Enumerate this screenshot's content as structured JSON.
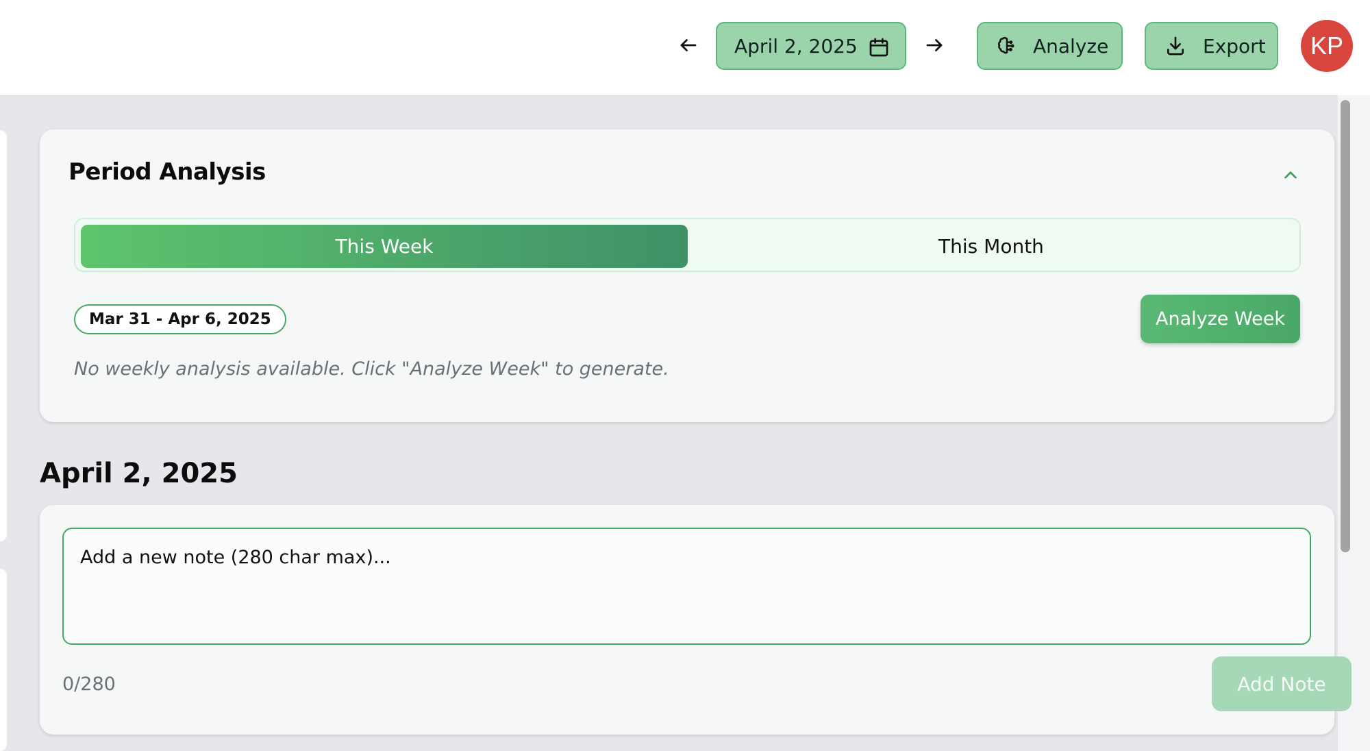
{
  "header": {
    "date_label": "April 2, 2025",
    "analyze_label": "Analyze",
    "export_label": "Export",
    "avatar_initials": "KP"
  },
  "period_analysis": {
    "title": "Period Analysis",
    "tabs": [
      {
        "label": "This Week",
        "active": true
      },
      {
        "label": "This Month",
        "active": false
      }
    ],
    "range_label": "Mar 31 - Apr 6, 2025",
    "analyze_week_label": "Analyze Week",
    "empty_message": "No weekly analysis available. Click \"Analyze Week\" to generate."
  },
  "day": {
    "heading": "April 2, 2025",
    "note_placeholder": "Add a new note (280 char max)...",
    "char_counter": "0/280",
    "add_note_label": "Add Note"
  },
  "colors": {
    "accent_green": "#4aa767",
    "button_green_bg": "#9bd3aa",
    "avatar_red": "#d9463e",
    "page_bg": "#e5e7eb"
  },
  "icons": {
    "prev": "arrow-left-icon",
    "next": "arrow-right-icon",
    "calendar": "calendar-icon",
    "analyze": "brain-icon",
    "export": "download-icon",
    "collapse": "chevron-up-icon"
  }
}
